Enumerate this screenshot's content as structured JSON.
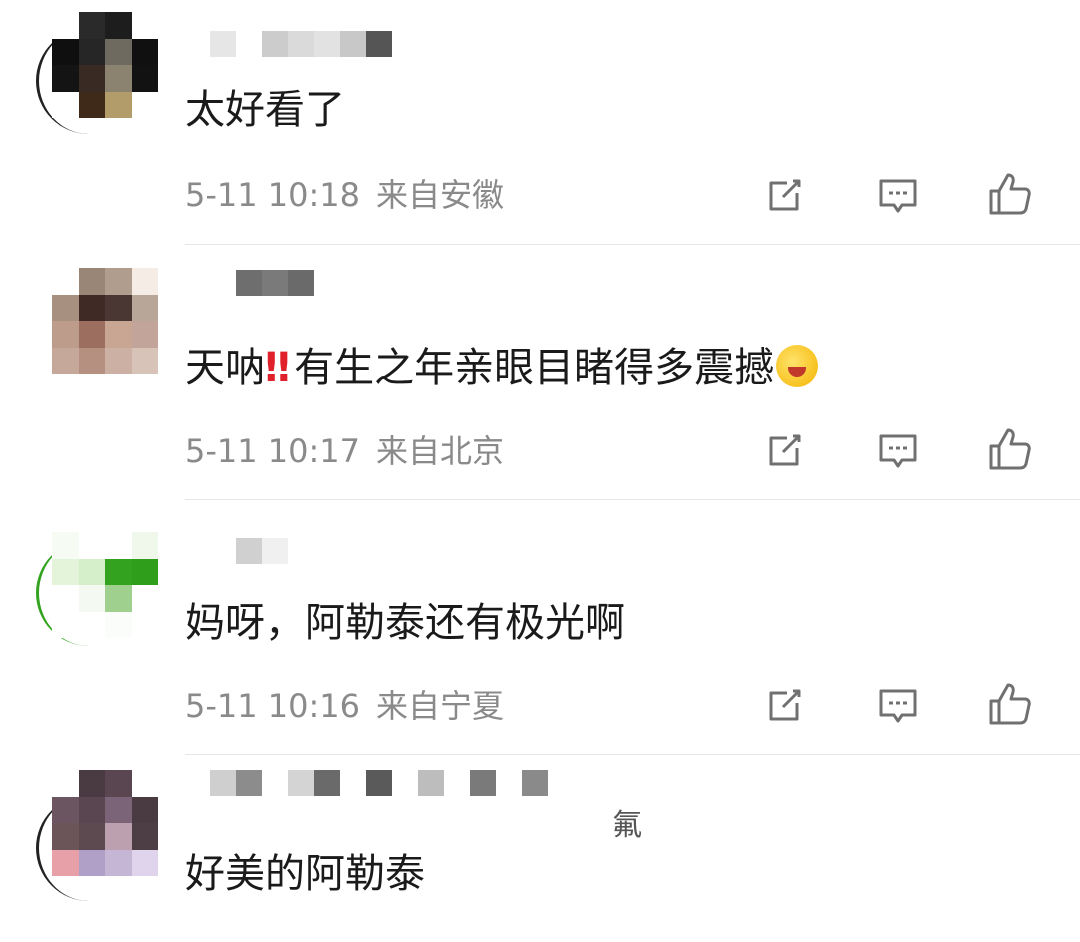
{
  "comments": [
    {
      "text": "太好看了",
      "time": "5-11 10:18",
      "location": "来自安徽",
      "avatar_colors": [
        "#ffffff",
        "#2a2a2a",
        "#1d1d1d",
        "#ffffff",
        "#0f0f0f",
        "#262626",
        "#6f6a60",
        "#101010",
        "#141414",
        "#3a2a24",
        "#8c8270",
        "#121212",
        "#ffffff",
        "#3f2a1a",
        "#b29d6a",
        "#ffffff"
      ],
      "name_colors": [
        "#e6e6e6",
        "#ffffff",
        "#cccccc",
        "#dadada",
        "#e2e2e2",
        "#c8c8c8",
        "#555555"
      ]
    },
    {
      "text_before": "天呐",
      "emoji_bang": "‼",
      "text_after": "有生之年亲眼目睹得多震撼",
      "time": "5-11 10:17",
      "location": "来自北京",
      "avatar_colors": [
        "#ffffff",
        "#9a8677",
        "#b19d8d",
        "#f6ece6",
        "#a89080",
        "#3f2a26",
        "#4a3632",
        "#b8a798",
        "#bd9c8c",
        "#9b6e60",
        "#c9a594",
        "#c2a49a",
        "#c5a899",
        "#b58f7f",
        "#cdb0a4",
        "#d7c3b8"
      ],
      "name_colors": [
        "#ffffff",
        "#6e6e6e",
        "#7a7a7a",
        "#6a6a6a"
      ]
    },
    {
      "text": "妈呀，阿勒泰还有极光啊",
      "time": "5-11 10:16",
      "location": "来自宁夏",
      "avatar_colors": [
        "#f6fbf3",
        "#ffffff",
        "#ffffff",
        "#f0f8ec",
        "#e3f4da",
        "#d6efcb",
        "#33a21f",
        "#2f9e1a",
        "#ffffff",
        "#f4faf1",
        "#9fd08d",
        "#ffffff",
        "#ffffff",
        "#ffffff",
        "#fbfdfa",
        "#ffffff"
      ],
      "name_colors": [
        "#ffffff",
        "#d0d0d0",
        "#f0f0f0"
      ]
    },
    {
      "text": "好美的阿勒泰",
      "avatar_colors": [
        "#ffffff",
        "#4a3a42",
        "#5a4650",
        "#ffffff",
        "#6b5560",
        "#5a4650",
        "#7c6478",
        "#4a3a42",
        "#6b5558",
        "#5c4a50",
        "#bca0b0",
        "#4d3d44",
        "#e8a0a8",
        "#b0a0c8",
        "#c4b6d4",
        "#e0d4ec"
      ],
      "name_colors": [
        "#cfcfcf",
        "#8c8c8c",
        "#ffffff",
        "#d4d4d4",
        "#6a6a6a",
        "#ffffff",
        "#5a5a5a",
        "#ffffff",
        "#bdbdbd",
        "#ffffff",
        "#7a7a7a",
        "#ffffff",
        "#8a8a8a"
      ],
      "name_tail": "氟"
    }
  ]
}
